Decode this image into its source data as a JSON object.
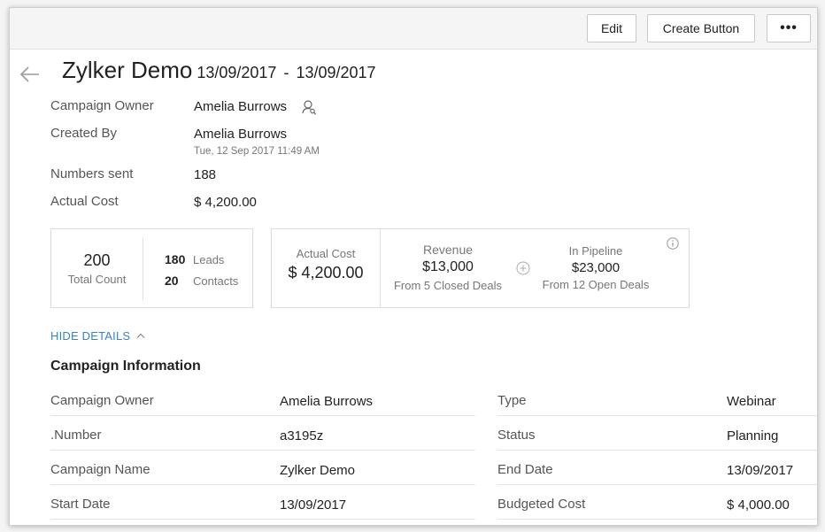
{
  "toolbar": {
    "edit_label": "Edit",
    "create_button_label": "Create Button",
    "more_label": "•••"
  },
  "header": {
    "title": "Zylker Demo",
    "start_date": "13/09/2017",
    "separator": "-",
    "end_date": "13/09/2017"
  },
  "summary": {
    "campaign_owner_label": "Campaign Owner",
    "campaign_owner_value": "Amelia Burrows",
    "created_by_label": "Created By",
    "created_by_value": "Amelia Burrows",
    "created_time": "Tue, 12 Sep 2017 11:49 AM",
    "numbers_sent_label": "Numbers sent",
    "numbers_sent_value": "188",
    "actual_cost_label": "Actual Cost",
    "actual_cost_value": "$ 4,200.00"
  },
  "stats": {
    "total_count": "200",
    "total_count_label": "Total Count",
    "leads_count": "180",
    "leads_label": "Leads",
    "contacts_count": "20",
    "contacts_label": "Contacts"
  },
  "finance": {
    "actual_cost_label": "Actual Cost",
    "actual_cost_value": "$ 4,200.00",
    "revenue_label": "Revenue",
    "revenue_value": "$13,000",
    "revenue_sub": "From 5 Closed Deals",
    "pipeline_label": "In Pipeline",
    "pipeline_value": "$23,000",
    "pipeline_sub": "From 12 Open Deals"
  },
  "details": {
    "hide_details_label": "HIDE DETAILS",
    "section_title": "Campaign Information",
    "left": [
      {
        "label": "Campaign Owner",
        "value": "Amelia Burrows"
      },
      {
        "label": ".Number",
        "value": "a3195z"
      },
      {
        "label": "Campaign Name",
        "value": "Zylker Demo"
      },
      {
        "label": "Start Date",
        "value": "13/09/2017"
      }
    ],
    "right": [
      {
        "label": "Type",
        "value": "Webinar"
      },
      {
        "label": "Status",
        "value": "Planning"
      },
      {
        "label": "End Date",
        "value": "13/09/2017"
      },
      {
        "label": "Budgeted Cost",
        "value": "$ 4,000.00"
      }
    ]
  },
  "colors": {
    "link": "#3b82c4",
    "toolbar_bg": "#f5f5f5",
    "border": "#dcdcdc"
  },
  "icons": [
    "back-arrow-icon",
    "owner-search-icon",
    "plus-circle-icon",
    "info-icon",
    "chevron-up-icon"
  ]
}
